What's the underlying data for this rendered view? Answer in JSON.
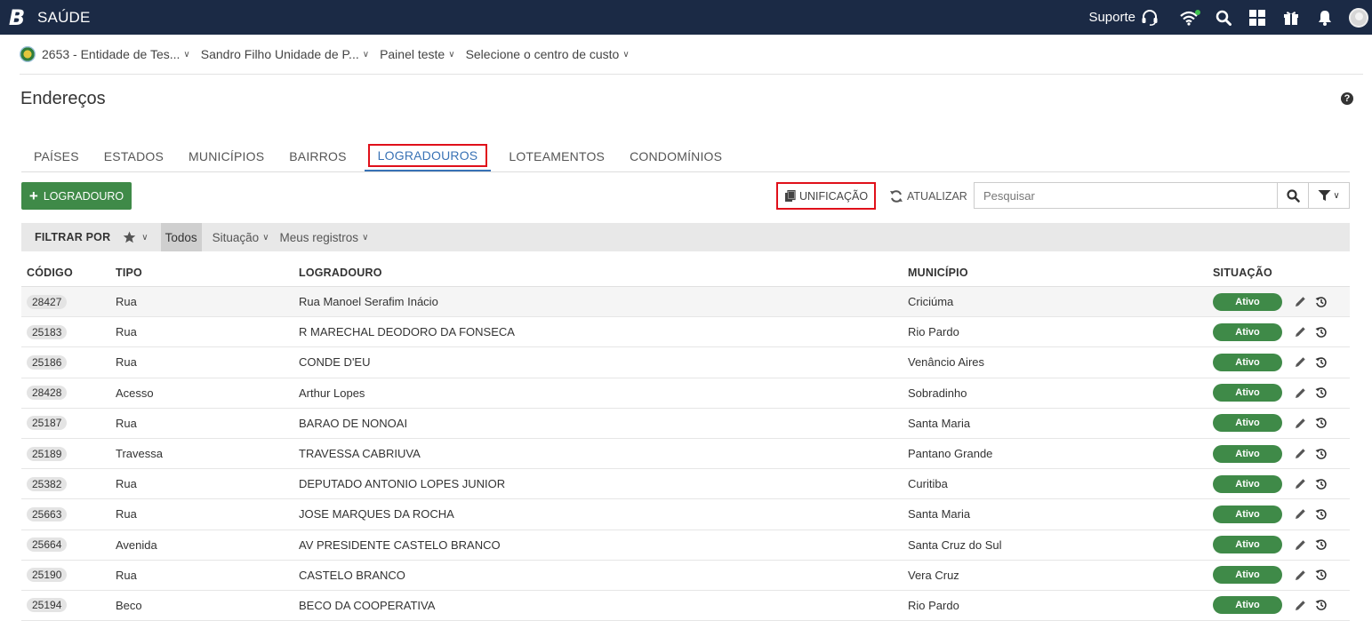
{
  "app": {
    "logo": "B",
    "title": "SAÚDE"
  },
  "topbar": {
    "support_label": "Suporte",
    "icons": [
      "headset-icon",
      "wifi-icon",
      "search-icon",
      "apps-grid-icon",
      "gift-icon",
      "bell-icon",
      "avatar"
    ]
  },
  "context": {
    "entity": "2653 - Entidade de Tes...",
    "unit": "Sandro Filho Unidade de P...",
    "panel": "Painel teste",
    "cost_center": "Selecione o centro de custo"
  },
  "page": {
    "title": "Endereços",
    "help": "?"
  },
  "tabs": [
    {
      "label": "PAÍSES",
      "active": false
    },
    {
      "label": "ESTADOS",
      "active": false
    },
    {
      "label": "MUNICÍPIOS",
      "active": false
    },
    {
      "label": "BAIRROS",
      "active": false
    },
    {
      "label": "LOGRADOUROS",
      "active": true
    },
    {
      "label": "LOTEAMENTOS",
      "active": false
    },
    {
      "label": "CONDOMÍNIOS",
      "active": false
    }
  ],
  "toolbar": {
    "add_label": "LOGRADOURO",
    "unify_label": "UNIFICAÇÃO",
    "refresh_label": "ATUALIZAR",
    "search_placeholder": "Pesquisar"
  },
  "filterbar": {
    "label": "FILTRAR POR",
    "todos": "Todos",
    "situacao": "Situação",
    "meus_registros": "Meus registros"
  },
  "table": {
    "headers": {
      "codigo": "CÓDIGO",
      "tipo": "TIPO",
      "logradouro": "LOGRADOURO",
      "municipio": "MUNICÍPIO",
      "situacao": "SITUAÇÃO"
    },
    "rows": [
      {
        "codigo": "28427",
        "tipo": "Rua",
        "logradouro": "Rua Manoel Serafim Inácio",
        "municipio": "Criciúma",
        "situacao": "Ativo"
      },
      {
        "codigo": "25183",
        "tipo": "Rua",
        "logradouro": "R MARECHAL DEODORO DA FONSECA",
        "municipio": "Rio Pardo",
        "situacao": "Ativo"
      },
      {
        "codigo": "25186",
        "tipo": "Rua",
        "logradouro": "CONDE D'EU",
        "municipio": "Venâncio Aires",
        "situacao": "Ativo"
      },
      {
        "codigo": "28428",
        "tipo": "Acesso",
        "logradouro": "Arthur Lopes",
        "municipio": "Sobradinho",
        "situacao": "Ativo"
      },
      {
        "codigo": "25187",
        "tipo": "Rua",
        "logradouro": "BARAO DE NONOAI",
        "municipio": "Santa Maria",
        "situacao": "Ativo"
      },
      {
        "codigo": "25189",
        "tipo": "Travessa",
        "logradouro": "TRAVESSA CABRIUVA",
        "municipio": "Pantano Grande",
        "situacao": "Ativo"
      },
      {
        "codigo": "25382",
        "tipo": "Rua",
        "logradouro": "DEPUTADO ANTONIO LOPES JUNIOR",
        "municipio": "Curitiba",
        "situacao": "Ativo"
      },
      {
        "codigo": "25663",
        "tipo": "Rua",
        "logradouro": "JOSE MARQUES DA ROCHA",
        "municipio": "Santa Maria",
        "situacao": "Ativo"
      },
      {
        "codigo": "25664",
        "tipo": "Avenida",
        "logradouro": "AV PRESIDENTE CASTELO BRANCO",
        "municipio": "Santa Cruz do Sul",
        "situacao": "Ativo"
      },
      {
        "codigo": "25190",
        "tipo": "Rua",
        "logradouro": "CASTELO BRANCO",
        "municipio": "Vera Cruz",
        "situacao": "Ativo"
      },
      {
        "codigo": "25194",
        "tipo": "Beco",
        "logradouro": "BECO DA COOPERATIVA",
        "municipio": "Rio Pardo",
        "situacao": "Ativo"
      }
    ]
  },
  "colors": {
    "topbar": "#1b2a45",
    "accent": "#3872b5",
    "success": "#3f8a48",
    "highlight": "#e0101a"
  }
}
